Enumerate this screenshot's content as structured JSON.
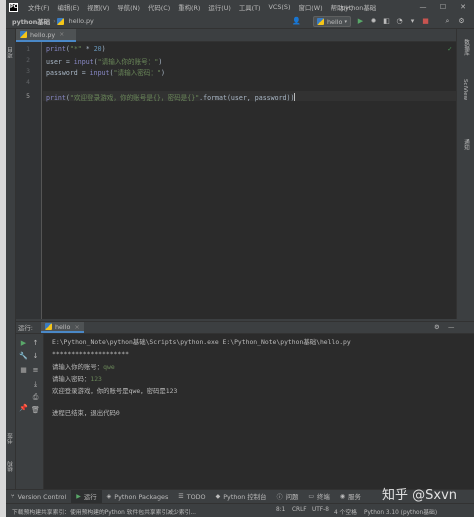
{
  "menubar": {
    "items": [
      "文件(F)",
      "编辑(E)",
      "视图(V)",
      "导航(N)",
      "代码(C)",
      "重构(R)",
      "运行(U)",
      "工具(T)",
      "VCS(S)",
      "窗口(W)",
      "帮助(H)"
    ],
    "window_title": "python基础",
    "minimize": "—",
    "maximize": "☐",
    "close": "✕"
  },
  "navbar": {
    "project": "python基础",
    "separator": "›",
    "file": "hello.py",
    "run_config": "hello",
    "user_icon": "user-icon",
    "run_icon": "run-icon",
    "debug_icon": "bug-icon",
    "search_icon": "search-icon",
    "settings_icon": "gear-icon"
  },
  "left_strip": {
    "project_label": "项目",
    "bookmarks_label": "书签",
    "structure_label": "结构"
  },
  "right_strip": {
    "database_label": "数据库",
    "sciview_label": "SciView",
    "notifications_label": "通知"
  },
  "editor": {
    "tab_label": "hello.py",
    "tab_close": "×",
    "line_numbers": [
      "1",
      "2",
      "3",
      "4",
      "5"
    ],
    "lines": [
      {
        "fn": "print",
        "open": "(",
        "s1": "\"*\"",
        "op": " * ",
        "num": "20",
        "close": ")"
      },
      {
        "plain": "user = ",
        "fn": "input",
        "open": "(",
        "s1": "\"请输入你的账号：\"",
        "close": ")"
      },
      {
        "plain": "password = ",
        "fn": "input",
        "open": "(",
        "s1": "\"请输入密码：\"",
        "close": ")"
      },
      {},
      {
        "fn": "print",
        "open": "(",
        "s1": "\"欢迎登录游戏，你的账号是{}，密码是{}\"",
        "plain": ".format(user, password)",
        "close": ")"
      }
    ],
    "check_mark": "✓"
  },
  "run_panel": {
    "header_label": "运行:",
    "tab_label": "hello",
    "tab_close": "×",
    "console": {
      "command": "E:\\Python_Note\\python基础\\Scripts\\python.exe E:\\Python_Note\\python基础\\hello.py",
      "stars": "********************",
      "prompt_account": "请输入你的账号：",
      "input_account": "qwe",
      "prompt_password": "请输入密码：",
      "input_password": "123",
      "welcome": "欢迎登录游戏，你的账号是qwe，密码是123",
      "exit_msg": "进程已结束，退出代码0"
    }
  },
  "bottom_tools": {
    "version_control": "Version Control",
    "run": "运行",
    "python_packages": "Python Packages",
    "todo": "TODO",
    "python_console": "Python 控制台",
    "problems": "问题",
    "terminal": "终端",
    "services": "服务"
  },
  "statusbar": {
    "message": "下载预构建共享索引：使用预构建的Python 软件包共享索引减少索引...",
    "line_col": "8:1",
    "line_sep": "CRLF",
    "encoding": "UTF-8",
    "indent": "4 个空格",
    "interpreter": "Python 3.10 (python基础)"
  },
  "watermark": "知乎 @Sxvn"
}
